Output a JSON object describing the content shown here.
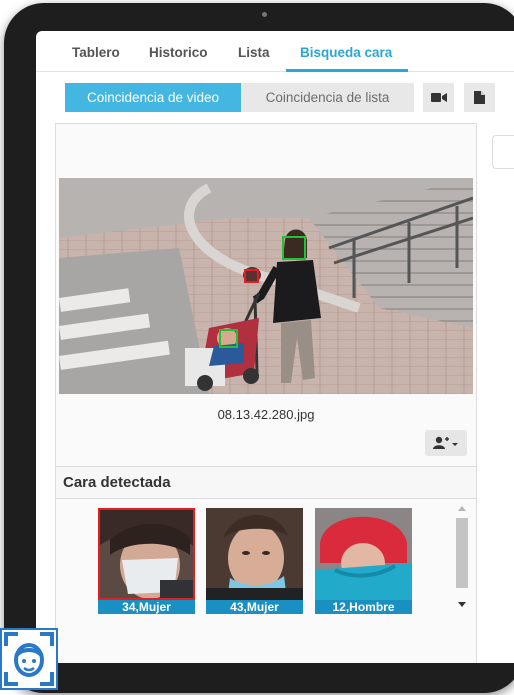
{
  "tabs": [
    {
      "label": "Tablero"
    },
    {
      "label": "Historico"
    },
    {
      "label": "Lista"
    },
    {
      "label": "Bisqueda cara"
    }
  ],
  "active_tab": 3,
  "segments": {
    "video": "Coincidencia de video",
    "list": "Coincidencia de lista"
  },
  "toolbar_icons": [
    "video-camera-icon",
    "document-icon"
  ],
  "image": {
    "filename": "08.13.42.280.jpg"
  },
  "detected": {
    "title": "Cara detectada",
    "faces": [
      {
        "label": "34,Mujer",
        "selected": true
      },
      {
        "label": "43,Mujer",
        "selected": false
      },
      {
        "label": "12,Hombre",
        "selected": false
      }
    ]
  },
  "colors": {
    "accent": "#2aa7d2",
    "segment_active": "#44b6e2",
    "label_bg": "#1a8fc2",
    "selected_border": "#e02020",
    "box_green": "#22c232",
    "box_red": "#e02020"
  }
}
